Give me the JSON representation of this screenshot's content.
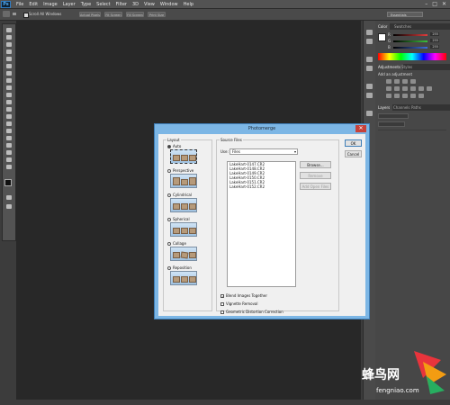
{
  "menubar": {
    "logo": "Ps",
    "items": [
      "File",
      "Edit",
      "Image",
      "Layer",
      "Type",
      "Select",
      "Filter",
      "3D",
      "View",
      "Window",
      "Help"
    ],
    "window_controls": [
      "–",
      "□",
      "✕"
    ]
  },
  "options": {
    "scroll_all_windows": "Scroll All Windows",
    "buttons": [
      "Actual Pixels",
      "Fit Screen",
      "Fill Screen",
      "Print Size"
    ],
    "workspace": "Essentials"
  },
  "panels": {
    "color_tabs": [
      "Color",
      "Swatches"
    ],
    "sliders": [
      {
        "label": "R",
        "value": "255",
        "color": "#e03c3c"
      },
      {
        "label": "G",
        "value": "255",
        "color": "#3cc23c"
      },
      {
        "label": "B",
        "value": "255",
        "color": "#3c6ee0"
      }
    ],
    "adjust_tabs": [
      "Adjustments",
      "Styles"
    ],
    "adjust_hint": "Add an adjustment",
    "layers_tabs": [
      "Layers",
      "Channels",
      "Paths"
    ]
  },
  "dialog": {
    "title": "Photomerge",
    "close": "✕",
    "layout_group": "Layout",
    "layouts": [
      {
        "label": "Auto",
        "selected": true
      },
      {
        "label": "Perspective",
        "selected": false
      },
      {
        "label": "Cylindrical",
        "selected": false
      },
      {
        "label": "Spherical",
        "selected": false
      },
      {
        "label": "Collage",
        "selected": false
      },
      {
        "label": "Reposition",
        "selected": false
      }
    ],
    "source_group": "Source Files",
    "use_label": "Use:",
    "use_value": "Files",
    "files": [
      "LakeHart-0147.CR2",
      "LakeHart-0148.CR2",
      "LakeHart-0149.CR2",
      "LakeHart-0150.CR2",
      "LakeHart-0151.CR2",
      "LakeHart-0152.CR2"
    ],
    "browse": "Browse...",
    "remove": "Remove",
    "add_open": "Add Open Files",
    "ok": "OK",
    "cancel": "Cancel",
    "options": [
      {
        "label": "Blend Images Together",
        "checked": true
      },
      {
        "label": "Vignette Removal",
        "checked": false
      },
      {
        "label": "Geometric Distortion Correction",
        "checked": false
      }
    ]
  },
  "watermark": {
    "line1": "蜂鸟网",
    "line2": "fengniao.com"
  },
  "colors": {
    "accent": "#2f7cc4",
    "dialog_border": "#7cb6e5",
    "close": "#c7413a"
  }
}
